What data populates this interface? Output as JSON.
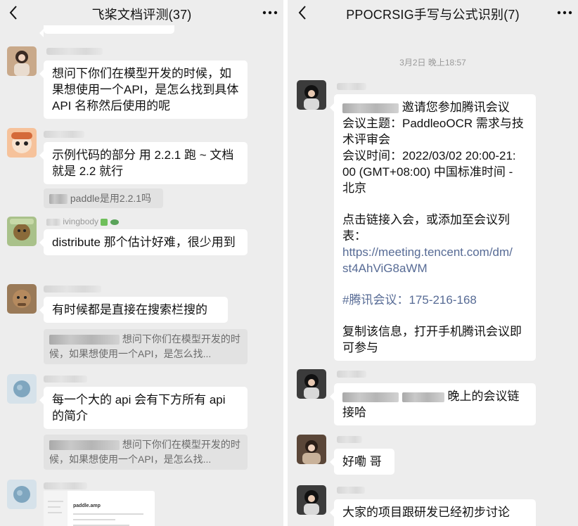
{
  "left_chat": {
    "title": "飞桨文档评测(37)",
    "messages": [
      {
        "text": "想问下你们在模型开发的时候，如果想使用一个API，是怎么找到具体API 名称然后使用的呢"
      },
      {
        "text": "示例代码的部分 用 2.2.1 跑 ~ 文档就是 2.2 就行",
        "quote": "paddle是用2.2.1吗"
      },
      {
        "sender_visible": "ivingbody",
        "text": "distribute 那个估计好难，很少用到"
      },
      {
        "text": "有时候都是直接在搜索栏搜的",
        "quote": "想问下你们在模型开发的时候，如果想使用一个API，是怎么找..."
      },
      {
        "text": "每一个大的 api 会有下方所有 api 的简介",
        "quote": "想问下你们在模型开发的时候，如果想使用一个API，是怎么找..."
      },
      {
        "attachment_title": "paddle.amp"
      }
    ]
  },
  "right_chat": {
    "title": "PPOCRSIG手写与公式识别(7)",
    "timestamp": "3月2日 晚上18:57",
    "invite": {
      "l1": "邀请您参加腾讯会议",
      "l2": "会议主题：PaddleoOCR 需求与技",
      "l3": "术评审会",
      "l4": "会议时间：2022/03/02 20:00-21:",
      "l5": "00 (GMT+08:00) 中国标准时间 -",
      "l6": "北京",
      "l7": "点击链接入会，或添加至会议列",
      "l8": "表：",
      "link1": "https://meeting.tencent.com/dm/",
      "link2": "st4AhViG8aWM",
      "meeting_id": "#腾讯会议：175-216-168",
      "l9": "复制该信息，打开手机腾讯会议即",
      "l10": "可参与"
    },
    "msg2_l1": "晚上的会议链",
    "msg2_l2": "接哈",
    "msg3": "好嘞  哥",
    "msg4": "大家的项目跟研发已经初步讨论"
  },
  "colors": {
    "chat_bg": "#ededed",
    "bubble": "#ffffff",
    "quote_bg": "#e2e2e2",
    "link": "#576b95"
  },
  "icons": [
    "back-arrow-icon",
    "more-dots-icon"
  ]
}
